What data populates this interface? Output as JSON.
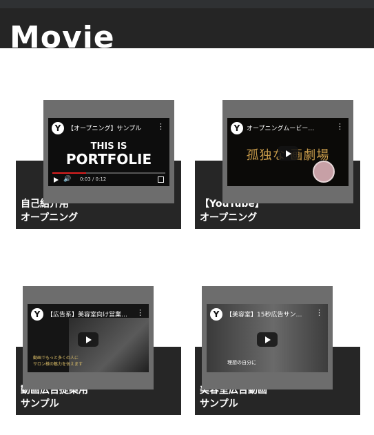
{
  "header": {
    "title": "Movie"
  },
  "cards": [
    {
      "caption_line1": "自己紹介用",
      "caption_line2": "オープニング",
      "video_title": "【オープニング】サンプル",
      "channel_initial": "Y",
      "artwork_line1": "THIS IS",
      "artwork_line2": "PORTFOLIE",
      "time": "0:03 / 0:12",
      "progress": 0.3
    },
    {
      "caption_line1": "【YouTube】",
      "caption_line2": "オープニング",
      "video_title": "オープニングムービー…",
      "channel_initial": "Y",
      "artwork_text": "孤独な 画劇場"
    },
    {
      "caption_line1": "動画広告提案用",
      "caption_line2": "サンプル",
      "video_title": "【広告系】美容室向け営業…",
      "channel_initial": "Y",
      "artwork_line1": "動画でもっと多くの人に",
      "artwork_line2": "サロン様の魅力を伝えます"
    },
    {
      "caption_line1": "美容室広告動画",
      "caption_line2": "サンプル",
      "video_title": "【美容室】15秒広告サン…",
      "channel_initial": "Y",
      "artwork_text": "理想の自分に"
    }
  ]
}
